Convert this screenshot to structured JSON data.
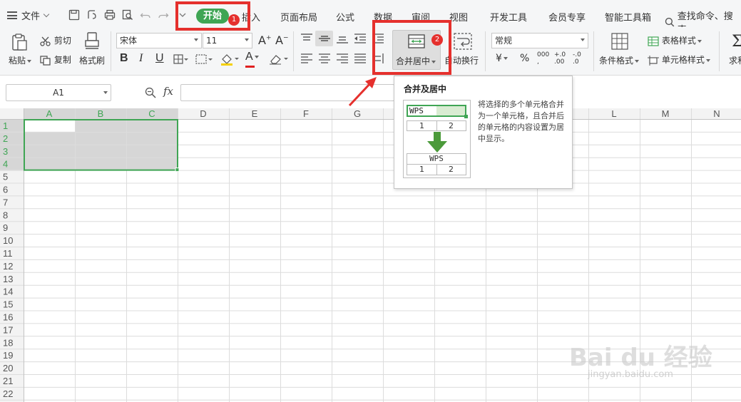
{
  "menu": {
    "file": "文件",
    "tabs": [
      "开始",
      "插入",
      "页面布局",
      "公式",
      "数据",
      "审阅",
      "视图",
      "开发工具",
      "会员专享",
      "智能工具箱"
    ],
    "search": "查找命令、搜索"
  },
  "ribbon": {
    "paste": "粘贴",
    "cut": "剪切",
    "copy": "复制",
    "format_painter": "格式刷",
    "font_name": "宋体",
    "font_size": "11",
    "number_format": "常规",
    "merge_center": "合并居中",
    "wrap_text": "自动换行",
    "conditional_format": "条件格式",
    "table_style": "表格样式",
    "cell_style": "单元格样式",
    "sum": "求和",
    "bold": "B",
    "italic": "I",
    "underline": "U",
    "percent": "%",
    "currency": "¥",
    "thousands": "000",
    "inc_decimal": "+.0",
    "dec_decimal": "-.0",
    "font_grow": "A",
    "font_shrink": "A"
  },
  "formula_bar": {
    "name_box": "A1",
    "fx": "fx"
  },
  "grid": {
    "columns": [
      "A",
      "B",
      "C",
      "D",
      "E",
      "F",
      "G",
      "H",
      "I",
      "J",
      "K",
      "L",
      "M",
      "N"
    ],
    "rows": [
      "1",
      "2",
      "3",
      "4",
      "5",
      "6",
      "7",
      "8",
      "9",
      "10",
      "11",
      "12",
      "13",
      "14",
      "15",
      "16",
      "17",
      "18",
      "19",
      "20",
      "21",
      "22"
    ],
    "selection": "A1:C4"
  },
  "tooltip": {
    "title": "合并及居中",
    "description": "将选择的多个单元格合并为一个单元格，且合并后的单元格的内容设置为居中显示。",
    "illus_text_top": "WPS",
    "illus_text_bottom": "WPS",
    "illus_num_1": "1",
    "illus_num_2": "2",
    "illus_num_3": "1",
    "illus_num_4": "2"
  },
  "annotations": {
    "badge_1": "1",
    "badge_2": "2"
  },
  "watermark": {
    "main": "Bai du 经验",
    "sub": "jingyan.baidu.com"
  },
  "colors": {
    "accent": "#3fa554",
    "annotation": "#e5302d",
    "selection_border": "#3fa554",
    "selection_fill": "#d6d6d6",
    "header_active": "#d6d6d6"
  }
}
